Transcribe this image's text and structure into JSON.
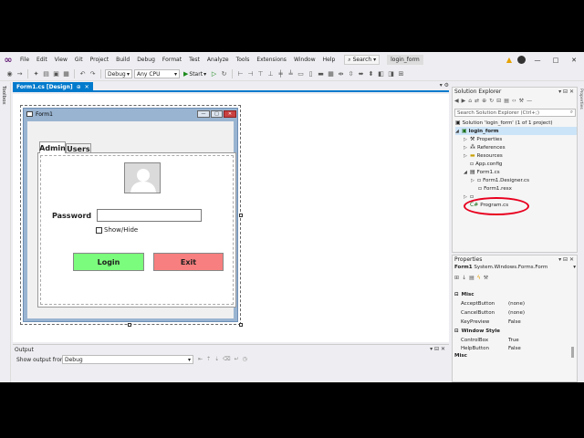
{
  "menubar": {
    "items": [
      "File",
      "Edit",
      "View",
      "Git",
      "Project",
      "Build",
      "Debug",
      "Format",
      "Test",
      "Analyze",
      "Tools",
      "Extensions",
      "Window",
      "Help"
    ],
    "search_label": "Search",
    "project_name": "login_form",
    "min_glyph": "—",
    "max_glyph": "□",
    "close_glyph": "✕"
  },
  "toolbar": {
    "config": "Debug",
    "platform": "Any CPU",
    "start_label": "Start"
  },
  "toolbox": {
    "label": "Toolbox"
  },
  "document_tab": {
    "label": "Form1.cs [Design]",
    "pin": "⊕",
    "close": "✕"
  },
  "form": {
    "title": "Form1",
    "tabs": [
      "Admin",
      "Users"
    ],
    "password_label": "Password",
    "show_hide_label": "Show/Hide",
    "login_label": "Login",
    "exit_label": "Exit",
    "colors": {
      "login": "#7cfc7c",
      "exit": "#f77f7f",
      "form_bg": "#99b4d1"
    }
  },
  "output": {
    "header": "Output",
    "show_from_label": "Show output from:",
    "source": "Debug"
  },
  "solution_explorer": {
    "title": "Solution Explorer",
    "search_placeholder": "Search Solution Explorer (Ctrl+;)",
    "tree": [
      {
        "label": "Solution 'login_form' (1 of 1 project)",
        "icon": "solution-icon"
      },
      {
        "label": "login_form",
        "icon": "csharp-project-icon",
        "selected": true
      },
      {
        "label": "Properties",
        "icon": "wrench-icon"
      },
      {
        "label": "References",
        "icon": "references-icon"
      },
      {
        "label": "Resources",
        "icon": "folder-icon"
      },
      {
        "label": "App.config",
        "icon": "config-file-icon"
      },
      {
        "label": "Form1.cs",
        "icon": "form-icon"
      },
      {
        "label": "Form1.Designer.cs",
        "icon": "cs-file-icon"
      },
      {
        "label": "Form1.resx",
        "icon": "resx-file-icon"
      },
      {
        "label": "Program.cs",
        "icon": "cs-file-icon"
      }
    ]
  },
  "properties": {
    "title": "Properties",
    "object_name": "Form1",
    "object_type": "System.Windows.Forms.Form",
    "categories": [
      {
        "name": "Misc",
        "rows": [
          {
            "name": "AcceptButton",
            "value": "(none)"
          },
          {
            "name": "CancelButton",
            "value": "(none)"
          },
          {
            "name": "KeyPreview",
            "value": "False"
          }
        ]
      },
      {
        "name": "Window Style",
        "rows": [
          {
            "name": "ControlBox",
            "value": "True"
          },
          {
            "name": "HelpButton",
            "value": "False"
          }
        ]
      }
    ],
    "footer_category": "Misc"
  }
}
